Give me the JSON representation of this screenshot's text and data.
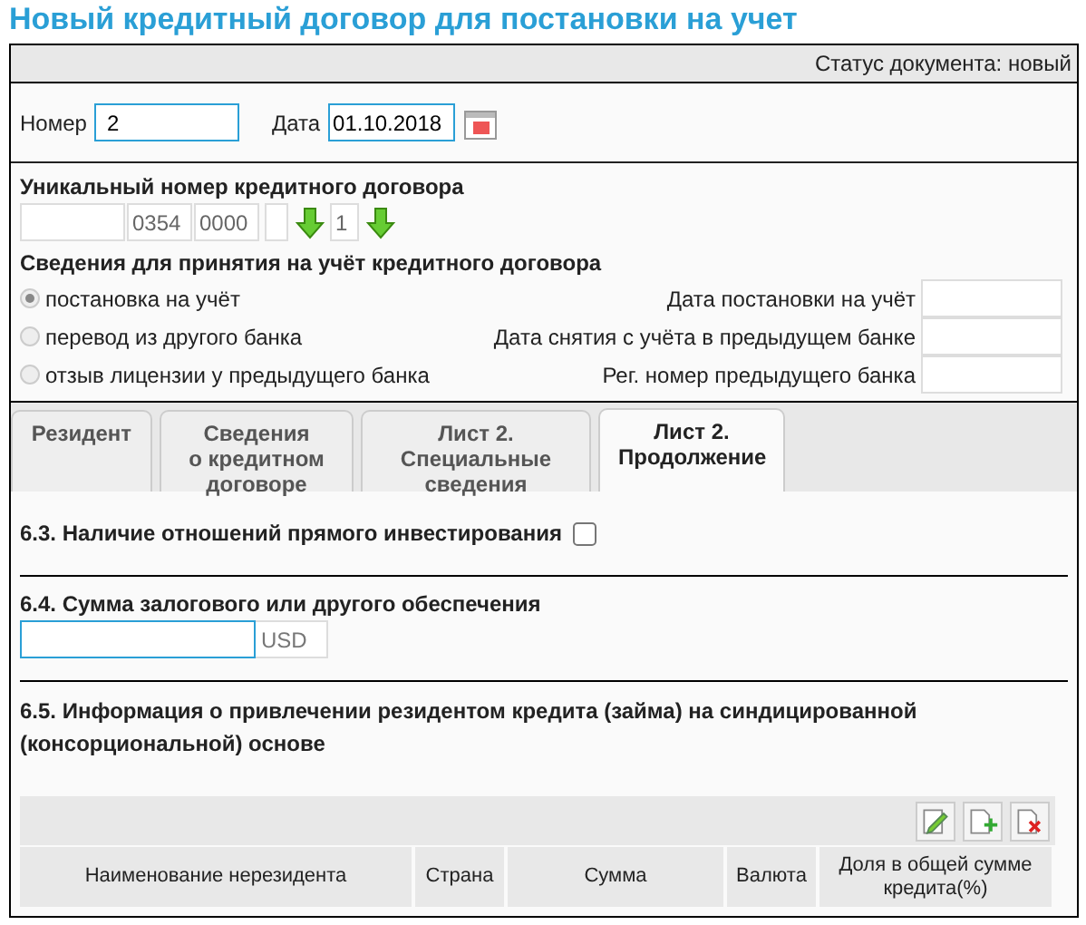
{
  "title": "Новый кредитный договор для постановки на учет",
  "status": {
    "label": "Статус документа:",
    "value": "новый"
  },
  "number": {
    "label": "Номер",
    "value": "2"
  },
  "date": {
    "label": "Дата",
    "value": "01.10.2018"
  },
  "unique_number": {
    "title": "Уникальный номер кредитного договора",
    "parts": [
      {
        "kind": "field"
      },
      {
        "kind": "field",
        "value": "0354"
      },
      {
        "kind": "field",
        "value": "0000"
      },
      {
        "kind": "field"
      },
      {
        "kind": "field",
        "value": "1"
      }
    ]
  },
  "registration": {
    "title": "Сведения для принятия на учёт кредитного договора",
    "options": [
      {
        "label": "постановка на учёт",
        "selected": true
      },
      {
        "label": "перевод из другого банка",
        "selected": false
      },
      {
        "label": "отзыв лицензии у предыдущего банка",
        "selected": false
      }
    ],
    "fields": [
      {
        "label": "Дата постановки на учёт"
      },
      {
        "label": "Дата снятия с учёта в предыдущем банке"
      },
      {
        "label": "Рег. номер предыдущего банка"
      }
    ]
  },
  "tabs": [
    {
      "label": "Резидент",
      "selected": false
    },
    {
      "label": "Сведения\nо кредитном\nдоговоре",
      "selected": false
    },
    {
      "label": "Лист 2.\nСпециальные\nсведения",
      "selected": false
    },
    {
      "label": "Лист 2.\nПродолжение",
      "selected": true
    }
  ],
  "direct_investment": {
    "label": "6.3. Наличие отношений прямого инвестирования",
    "checked": false
  },
  "collateral": {
    "label": "6.4. Сумма залогового или другого обеспечения",
    "currency": "USD"
  },
  "syndicated": {
    "label": "6.5. Информация о привлечении резидентом кредита (займа) на синдицированной (консорциональной) основе",
    "columns": [
      "Наименование нерезидента",
      "Страна",
      "Сумма",
      "Валюта",
      "Доля в общей сумме кредита(%)"
    ]
  }
}
